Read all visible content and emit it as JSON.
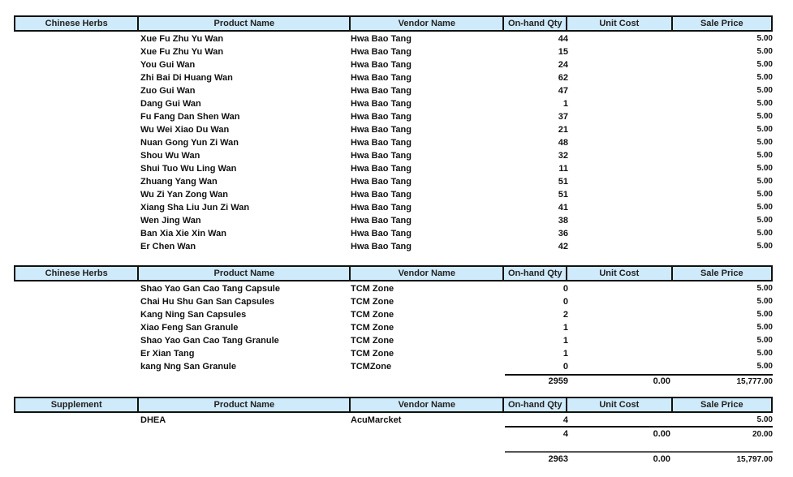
{
  "columns": {
    "product": "Product Name",
    "vendor": "Vendor Name",
    "qty": "On-hand Qty",
    "cost": "Unit Cost",
    "price": "Sale Price"
  },
  "sections": [
    {
      "category": "Chinese Herbs",
      "rows": [
        {
          "product": "Xue Fu Zhu Yu Wan",
          "vendor": "Hwa Bao Tang",
          "qty": "44",
          "price": "5.00"
        },
        {
          "product": "Xue Fu Zhu Yu Wan",
          "vendor": "Hwa Bao Tang",
          "qty": "15",
          "price": "5.00"
        },
        {
          "product": "You Gui Wan",
          "vendor": "Hwa Bao Tang",
          "qty": "24",
          "price": "5.00"
        },
        {
          "product": "Zhi Bai Di Huang Wan",
          "vendor": "Hwa Bao Tang",
          "qty": "62",
          "price": "5.00"
        },
        {
          "product": "Zuo Gui Wan",
          "vendor": "Hwa Bao Tang",
          "qty": "47",
          "price": "5.00"
        },
        {
          "product": "Dang Gui Wan",
          "vendor": "Hwa Bao Tang",
          "qty": "1",
          "price": "5.00"
        },
        {
          "product": "Fu Fang Dan Shen Wan",
          "vendor": "Hwa Bao Tang",
          "qty": "37",
          "price": "5.00"
        },
        {
          "product": "Wu Wei Xiao Du Wan",
          "vendor": "Hwa Bao Tang",
          "qty": "21",
          "price": "5.00"
        },
        {
          "product": "Nuan Gong Yun Zi Wan",
          "vendor": "Hwa Bao Tang",
          "qty": "48",
          "price": "5.00"
        },
        {
          "product": "Shou Wu Wan",
          "vendor": "Hwa Bao Tang",
          "qty": "32",
          "price": "5.00"
        },
        {
          "product": "Shui Tuo Wu Ling Wan",
          "vendor": "Hwa Bao Tang",
          "qty": "11",
          "price": "5.00"
        },
        {
          "product": "Zhuang Yang Wan",
          "vendor": "Hwa Bao Tang",
          "qty": "51",
          "price": "5.00"
        },
        {
          "product": "Wu Zi Yan Zong Wan",
          "vendor": "Hwa Bao Tang",
          "qty": "51",
          "price": "5.00"
        },
        {
          "product": "Xiang Sha Liu Jun Zi Wan",
          "vendor": "Hwa Bao Tang",
          "qty": "41",
          "price": "5.00"
        },
        {
          "product": "Wen Jing Wan",
          "vendor": "Hwa Bao Tang",
          "qty": "38",
          "price": "5.00"
        },
        {
          "product": "Ban Xia Xie Xin Wan",
          "vendor": "Hwa Bao Tang",
          "qty": "36",
          "price": "5.00"
        },
        {
          "product": "Er Chen Wan",
          "vendor": "Hwa Bao Tang",
          "qty": "42",
          "price": "5.00"
        }
      ]
    },
    {
      "category": "Chinese Herbs",
      "rows": [
        {
          "product": "Shao Yao Gan Cao Tang Capsule",
          "vendor": "TCM Zone",
          "qty": "0",
          "price": "5.00"
        },
        {
          "product": "Chai Hu Shu Gan San Capsules",
          "vendor": "TCM Zone",
          "qty": "0",
          "price": "5.00"
        },
        {
          "product": "Kang Ning San Capsules",
          "vendor": "TCM Zone",
          "qty": "2",
          "price": "5.00"
        },
        {
          "product": "Xiao Feng San Granule",
          "vendor": "TCM Zone",
          "qty": "1",
          "price": "5.00"
        },
        {
          "product": "Shao Yao Gan Cao Tang Granule",
          "vendor": "TCM Zone",
          "qty": "1",
          "price": "5.00"
        },
        {
          "product": "Er Xian Tang",
          "vendor": "TCM Zone",
          "qty": "1",
          "price": "5.00"
        },
        {
          "product": "kang Nng San Granule",
          "vendor": "TCMZone",
          "qty": "0",
          "price": "5.00"
        }
      ],
      "total": {
        "qty": "2959",
        "cost": "0.00",
        "price": "15,777.00"
      }
    },
    {
      "category": "Supplement",
      "rows": [
        {
          "product": "DHEA",
          "vendor": "AcuMarcket",
          "qty": "4",
          "price": "5.00"
        }
      ],
      "total": {
        "qty": "4",
        "cost": "0.00",
        "price": "20.00"
      }
    }
  ],
  "grand_total": {
    "qty": "2963",
    "cost": "0.00",
    "price": "15,797.00"
  }
}
